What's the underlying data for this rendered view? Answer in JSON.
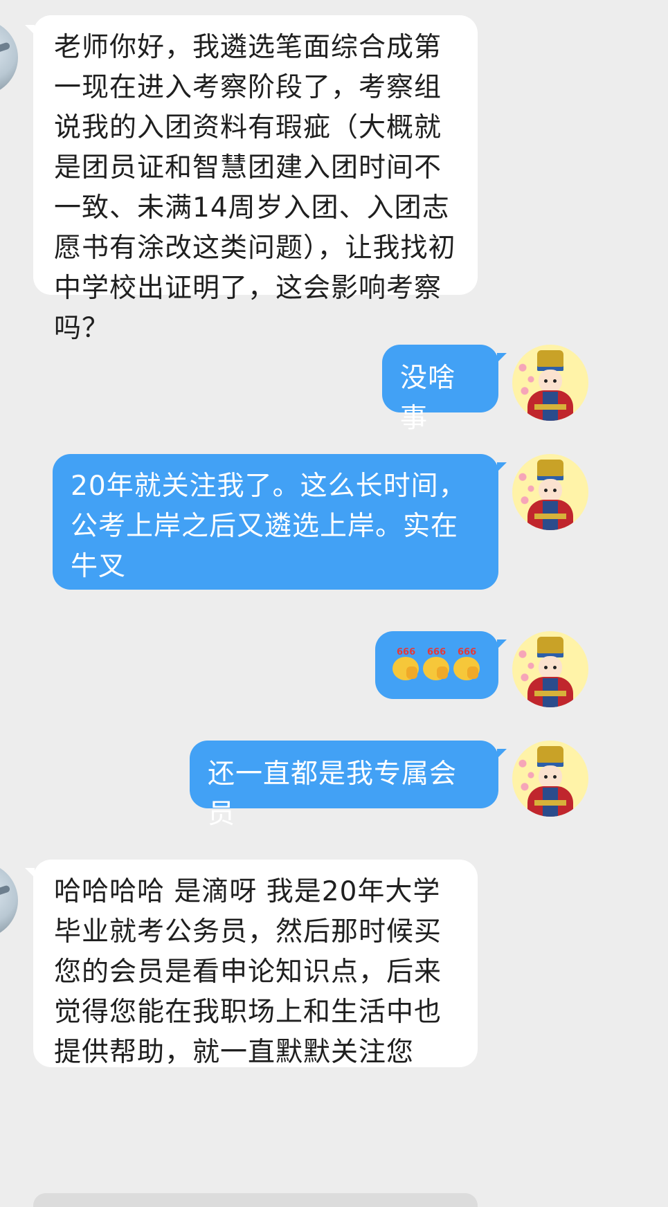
{
  "messages": [
    {
      "side": "incoming",
      "text": "老师你好，我遴选笔面综合成第一现在进入考察阶段了，考察组说我的入团资料有瑕疵（大概就是团员证和智慧团建入团时间不一致、未满14周岁入团、入团志愿书有涂改这类问题），让我找初中学校出证明了，这会影响考察吗？"
    },
    {
      "side": "outgoing",
      "text": "没啥事"
    },
    {
      "side": "outgoing",
      "text": "20年就关注我了。这么长时间，公考上岸之后又遴选上岸。实在牛叉"
    },
    {
      "side": "outgoing",
      "emoji": [
        "666-emoji",
        "666-emoji",
        "666-emoji"
      ],
      "emoji_label": "666"
    },
    {
      "side": "outgoing",
      "text": "还一直都是我专属会员"
    },
    {
      "side": "incoming",
      "text": "哈哈哈哈 是滴呀 我是20年大学毕业就考公务员，然后那时候买您的会员是看申论知识点，后来觉得您能在我职场上和生活中也提供帮助，就一直默默关注您"
    }
  ],
  "colors": {
    "background": "#ededed",
    "incoming_bubble": "#ffffff",
    "outgoing_bubble": "#42a1f5",
    "incoming_text": "#1f1f1f",
    "outgoing_text": "#ffffff"
  }
}
